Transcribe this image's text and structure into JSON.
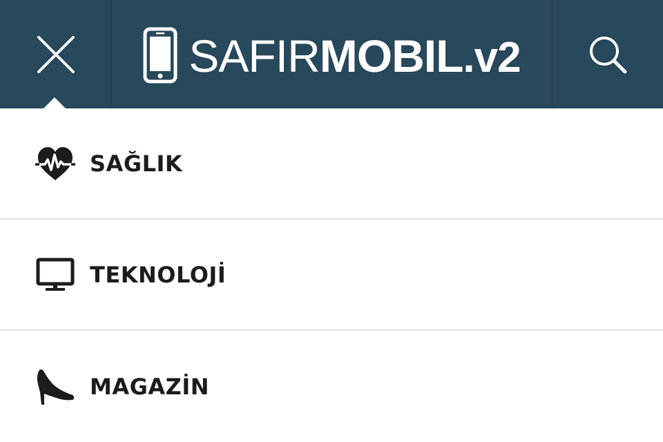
{
  "header": {
    "logo": {
      "part_light": "SAFIR",
      "part_bold": "MOBIL",
      "part_version": ".v2"
    },
    "close_icon": "close-icon",
    "search_icon": "search-icon",
    "background_color": "#28485b"
  },
  "menu": {
    "items": [
      {
        "label": "SAĞLIK",
        "icon": "heart-pulse-icon"
      },
      {
        "label": "TEKNOLOJİ",
        "icon": "monitor-icon"
      },
      {
        "label": "MAGAZİN",
        "icon": "high-heel-icon"
      }
    ]
  }
}
